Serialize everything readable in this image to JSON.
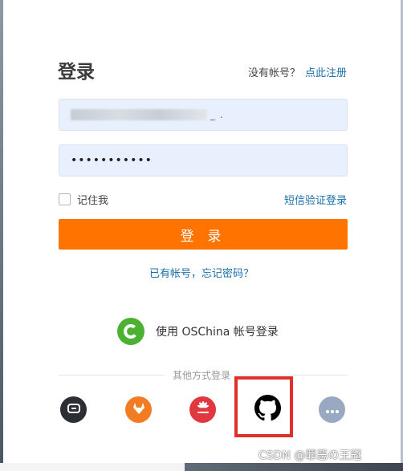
{
  "header": {
    "title": "登录",
    "register_prompt": "没有帐号？",
    "register_link": "点此注册"
  },
  "form": {
    "username_value": "_ .",
    "password_value": "•••••••••••",
    "remember_label": "记住我",
    "sms_login_link": "短信验证登录",
    "login_button": "登 录",
    "forgot_link": "已有帐号，忘记密码？"
  },
  "oschina": {
    "label": "使用 OSChina 帐号登录",
    "icon": "oschina-icon"
  },
  "social": {
    "divider_label": "其他方式登录",
    "items": [
      {
        "name": "gitee",
        "icon": "gitee-icon",
        "color": "#2b2f33"
      },
      {
        "name": "gitlab",
        "icon": "gitlab-icon",
        "color": "#f27c21"
      },
      {
        "name": "huawei",
        "icon": "huawei-icon",
        "color": "#e0383e"
      },
      {
        "name": "github",
        "icon": "github-icon",
        "color": "#000000"
      },
      {
        "name": "more",
        "icon": "more-icon",
        "color": "#9aa9c2"
      }
    ]
  },
  "watermark": "CSDN @罪恶の王冠",
  "colors": {
    "accent": "#ff7300",
    "link": "#1a6fa8",
    "highlight": "#e0302a",
    "oschina_green": "#4cb131"
  }
}
